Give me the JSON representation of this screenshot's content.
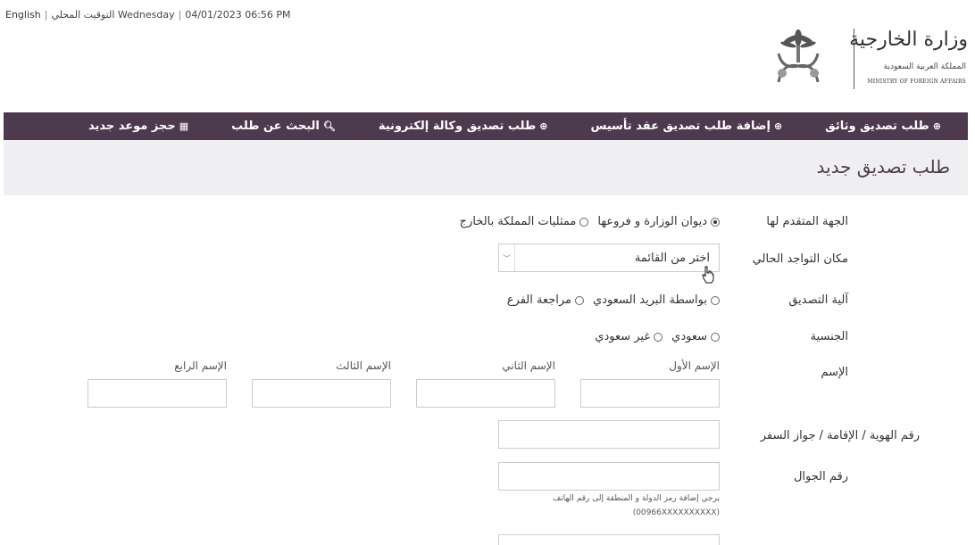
{
  "topbar": {
    "lang": "English",
    "local_time_label": "التوقيت المحلي",
    "day": "Wednesday",
    "datetime": "04/01/2023 06:56 PM"
  },
  "logo": {
    "ar_title": "وزارة الخارجية",
    "ar_sub": "المملكة العربية السعودية",
    "en_sub": "MINISTRY OF FOREIGN AFFAIRS"
  },
  "nav": {
    "items": [
      {
        "label": "طلب تصديق وثائق",
        "icon": "plus-circle-icon"
      },
      {
        "label": "إضافة طلب تصديق عقد تأسيس",
        "icon": "plus-circle-icon"
      },
      {
        "label": "طلب تصديق وكالة إلكترونية",
        "icon": "plus-circle-icon"
      },
      {
        "label": "البحث عن طلب",
        "icon": "search-icon"
      },
      {
        "label": "حجز موعد جديد",
        "icon": "calendar-icon"
      }
    ]
  },
  "page": {
    "title": "طلب تصديق جديد"
  },
  "form": {
    "authority": {
      "label": "الجهة المتقدم لها",
      "options": [
        "ديوان الوزارة و فروعها",
        "ممثليات المملكة بالخارج"
      ],
      "selected": 0
    },
    "location": {
      "label": "مكان التواجد الحالي",
      "placeholder": "اختر من القائمة"
    },
    "mechanism": {
      "label": "آلية التصديق",
      "options": [
        "بواسطة البريد السعودي",
        "مراجعة الفرع"
      ]
    },
    "nationality": {
      "label": "الجنسية",
      "options": [
        "سعودي",
        "غير سعودي"
      ]
    },
    "name": {
      "label": "الإسم",
      "parts": [
        "الإسم الأول",
        "الإسم الثاني",
        "الإسم الثالث",
        "الإسم الرابع"
      ]
    },
    "id_number": {
      "label": "رقم الهوية / الإقامة / جواز السفر"
    },
    "mobile": {
      "label": "رقم الجوال",
      "hint_line1": "يرجي إضافة رمز الدولة و المنطقة إلى رقم الهاتف",
      "hint_line2": "(00966XXXXXXXXXX)"
    }
  }
}
